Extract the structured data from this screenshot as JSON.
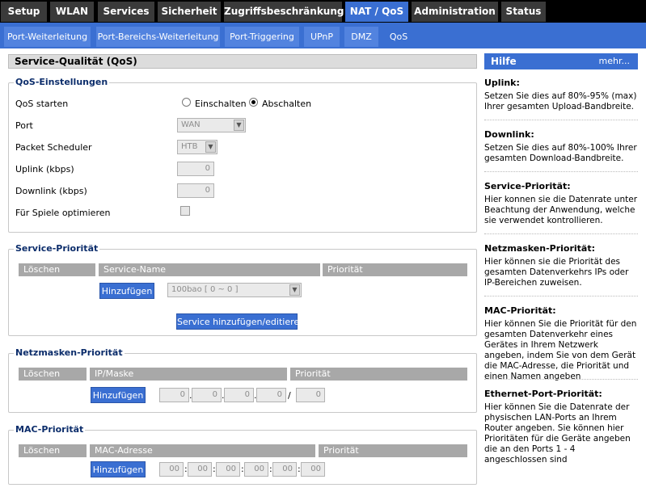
{
  "nav": {
    "tabs": [
      "Setup",
      "WLAN",
      "Services",
      "Sicherheit",
      "Zugriffsbeschränkung",
      "NAT / QoS",
      "Administration",
      "Status"
    ],
    "active": "NAT / QoS"
  },
  "subnav": {
    "tabs": [
      "Port-Weiterleitung",
      "Port-Bereichs-Weiterleitung",
      "Port-Triggering",
      "UPnP",
      "DMZ",
      "QoS"
    ],
    "active": "QoS"
  },
  "page": {
    "title": "Service-Qualität (QoS)"
  },
  "qos": {
    "legend": "QoS-Einstellungen",
    "start_label": "QoS starten",
    "opt_on": "Einschalten",
    "opt_off": "Abschalten",
    "selected": "Abschalten",
    "port_label": "Port",
    "port_value": "WAN",
    "sched_label": "Packet Scheduler",
    "sched_value": "HTB",
    "uplink_label": "Uplink (kbps)",
    "uplink_value": "0",
    "downlink_label": "Downlink (kbps)",
    "downlink_value": "0",
    "games_label": "Für Spiele optimieren"
  },
  "service": {
    "legend": "Service-Priorität",
    "headers": [
      "Löschen",
      "Service-Name",
      "Priorität"
    ],
    "add": "Hinzufügen",
    "select_value": "100bao [ 0 ~ 0 ]",
    "edit": "Service hinzufügen/editieren"
  },
  "netmask": {
    "legend": "Netzmasken-Priorität",
    "headers": [
      "Löschen",
      "IP/Maske",
      "Priorität"
    ],
    "add": "Hinzufügen",
    "ip": [
      "0",
      "0",
      "0",
      "0"
    ],
    "mask": "0"
  },
  "mac": {
    "legend": "MAC-Priorität",
    "headers": [
      "Löschen",
      "MAC-Adresse",
      "Priorität"
    ],
    "add": "Hinzufügen",
    "octets": [
      "00",
      "00",
      "00",
      "00",
      "00",
      "00"
    ]
  },
  "help": {
    "title": "Hilfe",
    "more": "mehr...",
    "sections": [
      {
        "title": "Uplink:",
        "text": "Setzen Sie dies auf 80%-95% (max) Ihrer gesamten Upload-Bandbreite."
      },
      {
        "title": "Downlink:",
        "text": "Setzen Sie dies auf 80%-100% Ihrer gesamten Download-Bandbreite."
      },
      {
        "title": "Service-Priorität:",
        "text": "Hier konnen sie die Datenrate unter Beachtung der Anwendung, welche sie verwendet kontrollieren."
      },
      {
        "title": "Netzmasken-Priorität:",
        "text": "Hier können sie die Priorität des gesamten Datenverkehrs IPs oder IP-Bereichen zuweisen."
      },
      {
        "title": "MAC-Priorität:",
        "text": "Hier können Sie die Priorität für den gesamten Datenverkehr eines Gerätes in Ihrem Netzwerk angeben, indem Sie von dem Gerät die MAC-Adresse, die Priorität und einen Namen angeben"
      },
      {
        "title": "Ethernet-Port-Priorität:",
        "text": "Hier können Sie die Datenrate der physischen LAN-Ports an Ihrem Router angeben. Sie können hier Prioritäten für die Geräte angeben die an den Ports 1 - 4 angeschlossen sind"
      }
    ]
  }
}
